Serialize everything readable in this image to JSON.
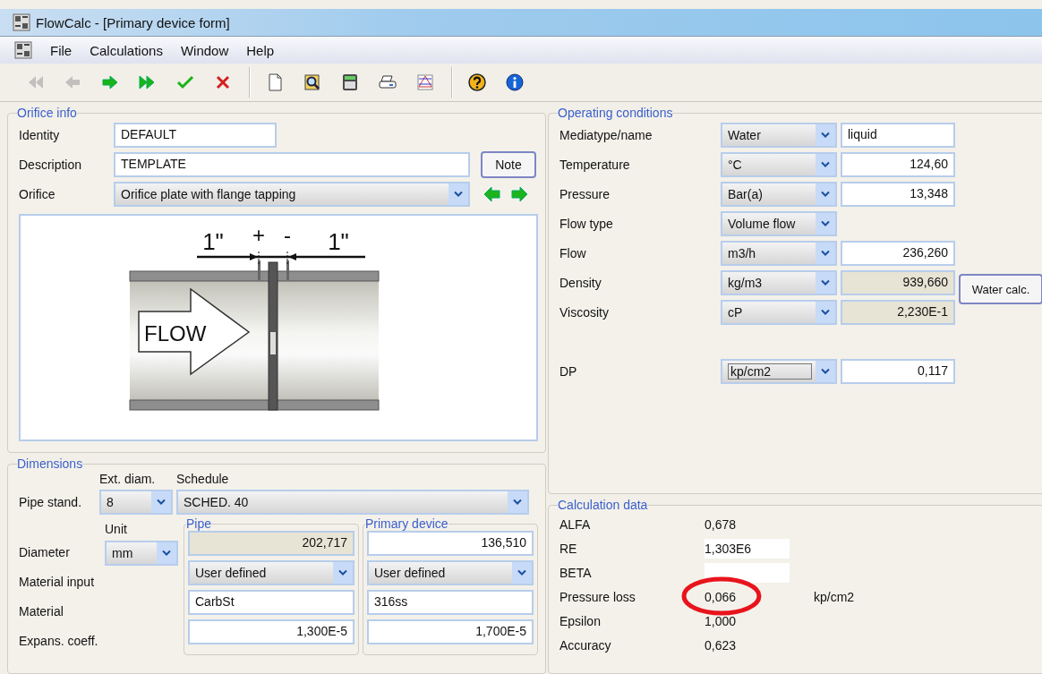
{
  "window": {
    "title": "FlowCalc - [Primary device form]"
  },
  "menu": [
    {
      "label": "File"
    },
    {
      "label": "Calculations"
    },
    {
      "label": "Window"
    },
    {
      "label": "Help"
    }
  ],
  "toolbar": [
    [
      {
        "kind": "first",
        "disabled": true
      },
      {
        "kind": "previous",
        "disabled": true
      },
      {
        "kind": "next",
        "disabled": false
      },
      {
        "kind": "last",
        "disabled": false
      },
      {
        "kind": "confirm",
        "disabled": false
      },
      {
        "kind": "cancel",
        "disabled": false
      }
    ],
    [
      {
        "kind": "new",
        "disabled": false
      },
      {
        "kind": "preview",
        "disabled": false
      },
      {
        "kind": "calculator",
        "disabled": false
      },
      {
        "kind": "print",
        "disabled": false
      },
      {
        "kind": "chart",
        "disabled": false
      }
    ],
    [
      {
        "kind": "help",
        "disabled": false
      },
      {
        "kind": "info",
        "disabled": false
      }
    ]
  ],
  "orifice_info": {
    "title": "Orifice info",
    "identity": {
      "label": "Identity",
      "value": "DEFAULT"
    },
    "description": {
      "label": "Description",
      "value": "TEMPLATE"
    },
    "note_button": "Note",
    "orifice": {
      "label": "Orifice",
      "value": "Orifice plate with flange tapping"
    },
    "diagram": {
      "left_distance": "1\"",
      "plus": "+",
      "minus": "-",
      "right_distance": "1\"",
      "flow": "FLOW"
    }
  },
  "operating_conditions": {
    "title": "Operating conditions",
    "rows": [
      {
        "label": "Mediatype/name",
        "unit": "Water",
        "value": "liquid",
        "kind": "text"
      },
      {
        "label": "Temperature",
        "unit": "°C",
        "value": "124,60",
        "kind": "input"
      },
      {
        "label": "Pressure",
        "unit": "Bar(a)",
        "value": "13,348",
        "kind": "input"
      },
      {
        "label": "Flow type",
        "unit": "Volume flow",
        "kind": "select"
      },
      {
        "label": "Flow",
        "unit": "m3/h",
        "value": "236,260",
        "kind": "input"
      },
      {
        "label": "Density",
        "unit": "kg/m3",
        "value": "939,660",
        "kind": "computed"
      },
      {
        "label": "Viscosity",
        "unit": "cP",
        "value": "2,230E-1",
        "kind": "computed"
      }
    ],
    "water_calc_button": "Water calc.",
    "dp": {
      "label": "DP",
      "unit": "kp/cm2",
      "value": "0,117"
    }
  },
  "dimensions": {
    "title": "Dimensions",
    "ext_diam_label": "Ext. diam.",
    "schedule_label": "Schedule",
    "pipe_stand": {
      "label": "Pipe stand.",
      "ext_diam": "8",
      "schedule": "SCHED. 40"
    },
    "unit_label": "Unit",
    "row_labels": [
      "Diameter",
      "Material input",
      "Material",
      "Expans. coeff."
    ],
    "diameter_unit": "mm",
    "groups": [
      {
        "title": "Pipe",
        "diameter": "202,717",
        "diameter_computed": true,
        "material_input": "User defined",
        "material": "CarbSt",
        "expansion": "1,300E-5"
      },
      {
        "title": "Primary device",
        "diameter": "136,510",
        "diameter_computed": false,
        "material_input": "User defined",
        "material": "316ss",
        "expansion": "1,700E-5"
      }
    ]
  },
  "calculation_data": {
    "title": "Calculation data",
    "rows": [
      {
        "label": "ALFA",
        "value": "0,678",
        "boxed": false
      },
      {
        "label": "RE",
        "value": "1,303E6",
        "boxed": true
      },
      {
        "label": "BETA",
        "boxed": true
      },
      {
        "label": "Pressure loss",
        "value": "0,066",
        "boxed": false,
        "unit": "kp/cm2",
        "circled": true
      },
      {
        "label": "Epsilon",
        "value": "1,000",
        "boxed": false
      },
      {
        "label": "Accuracy",
        "value": "0,623",
        "boxed": false
      }
    ]
  }
}
